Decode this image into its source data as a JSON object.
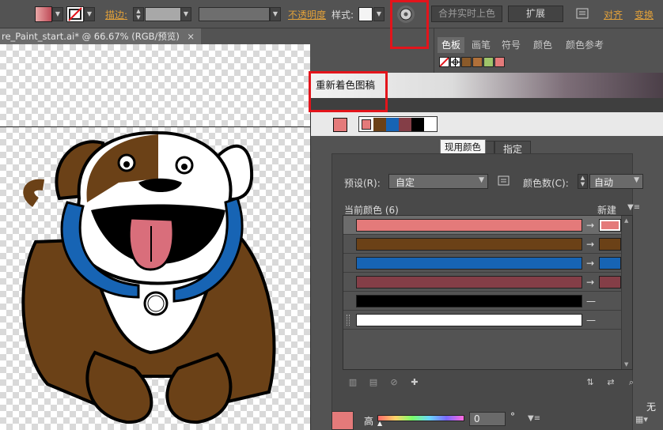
{
  "toolbar": {
    "stroke_label": "描边:",
    "opacity_label": "不透明度",
    "style_label": "样式:",
    "merge_button": "合并实时上色",
    "expand_button": "扩展",
    "align_link": "对齐",
    "transform_link": "变换"
  },
  "document_tab": {
    "title": "re_Paint_start.ai* @ 66.67% (RGB/预览)",
    "close": "×"
  },
  "swatch_panel": {
    "tabs": [
      "色板",
      "画笔",
      "符号",
      "颜色",
      "颜色参考"
    ],
    "active_tab": "色板"
  },
  "dialog": {
    "title": "重新着色图稿",
    "tooltip": "现用颜色",
    "tab_assign": "指定",
    "preset_label": "预设(R):",
    "preset_value": "自定",
    "color_count_label": "颜色数(C):",
    "color_count_value": "自动",
    "current_colors_label": "当前颜色 (6)",
    "new_label": "新建",
    "arrow": "→",
    "dash": "—",
    "bottom_label": "高",
    "bottom_value": "0",
    "bottom_unit": "°",
    "bottom_right_label": "无"
  },
  "colors": {
    "pink": "#e47a7a",
    "brown": "#6b4117",
    "blue": "#1764b4",
    "maroon": "#843e47",
    "black": "#000000",
    "white": "#ffffff",
    "highlight_red": "#e3141b"
  }
}
